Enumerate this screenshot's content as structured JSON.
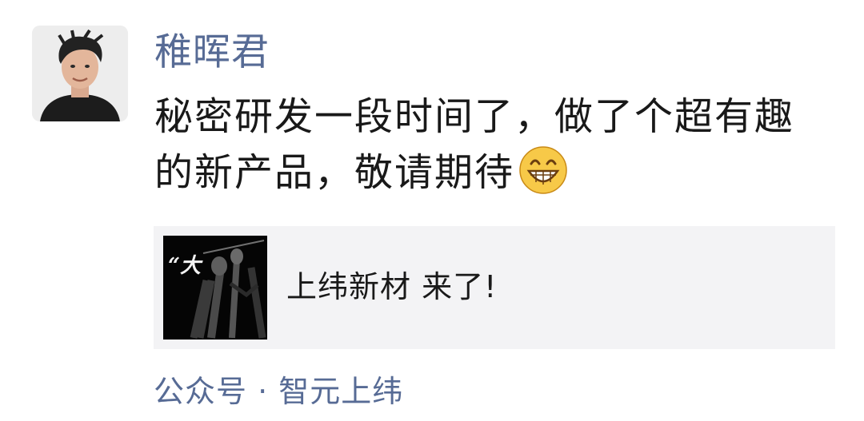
{
  "post": {
    "author": "稚晖君",
    "text_line1": "秘密研发一段时间了，做了个超有趣",
    "text_line2": "的新产品，敬请期待",
    "emoji": "grin-emoji"
  },
  "link_card": {
    "title": "上纬新材 来了!",
    "thumbnail_text": "“大"
  },
  "source": {
    "label": "公众号 · 智元上纬"
  },
  "colors": {
    "name_link": "#576b95",
    "body_text": "#191919",
    "card_bg": "#f3f3f5"
  }
}
